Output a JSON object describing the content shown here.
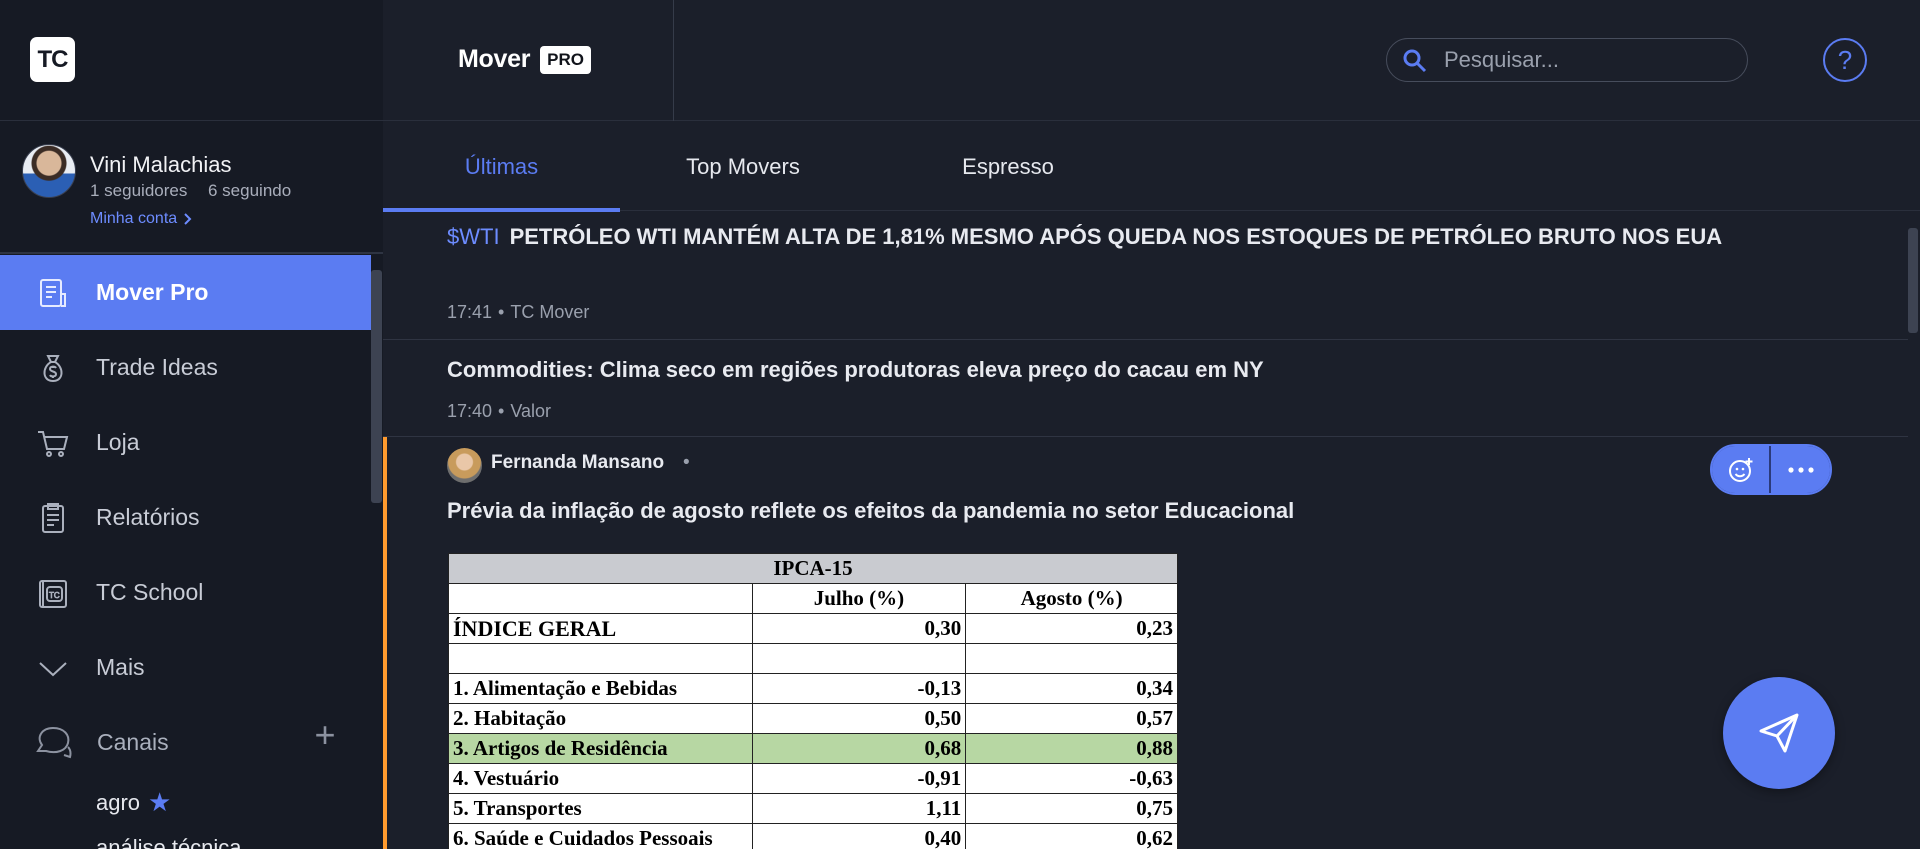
{
  "app": {
    "logo_text": "TC"
  },
  "user": {
    "name": "Vini Malachias",
    "followers": "1 seguidores",
    "following": "6 seguindo",
    "account_link": "Minha conta"
  },
  "nav": {
    "items": [
      {
        "label": "Mover Pro",
        "icon": "document-icon",
        "active": true
      },
      {
        "label": "Trade Ideas",
        "icon": "money-bag-icon",
        "active": false
      },
      {
        "label": "Loja",
        "icon": "cart-icon",
        "active": false
      },
      {
        "label": "Relatórios",
        "icon": "report-icon",
        "active": false
      },
      {
        "label": "TC School",
        "icon": "school-icon",
        "active": false
      },
      {
        "label": "Mais",
        "icon": "chevron-down-icon",
        "active": false
      }
    ]
  },
  "channels": {
    "label": "Canais",
    "items": [
      "agro",
      "análise técnica"
    ]
  },
  "header": {
    "brand": "Mover",
    "badge": "PRO",
    "search_placeholder": "Pesquisar...",
    "help": "?"
  },
  "tabs": [
    {
      "label": "Últimas",
      "active": true
    },
    {
      "label": "Top Movers",
      "active": false
    },
    {
      "label": "Espresso",
      "active": false
    }
  ],
  "feed": {
    "news": [
      {
        "ticker": "$WTI",
        "title": "PETRÓLEO WTI MANTÉM ALTA DE 1,81% MESMO APÓS QUEDA NOS ESTOQUES DE PETRÓLEO BRUTO NOS EUA",
        "time": "17:41",
        "source": "TC Mover"
      },
      {
        "ticker": "",
        "title": "Commodities: Clima seco em regiões produtoras eleva preço do cacau em NY",
        "time": "17:40",
        "source": "Valor"
      }
    ],
    "post": {
      "author": "Fernanda Mansano",
      "title": "Prévia da inflação de agosto reflete os efeitos da pandemia no setor Educacional",
      "accent_color": "#ff9b2e",
      "table": {
        "title": "IPCA-15",
        "columns": [
          "Julho (%)",
          "Agosto (%)"
        ],
        "rows": [
          {
            "label": "ÍNDICE GERAL",
            "julho": "0,30",
            "agosto": "0,23",
            "highlight": false
          },
          {
            "label": "",
            "julho": "",
            "agosto": "",
            "highlight": false
          },
          {
            "label": "1. Alimentação e Bebidas",
            "julho": "-0,13",
            "agosto": "0,34",
            "highlight": false
          },
          {
            "label": "2. Habitação",
            "julho": "0,50",
            "agosto": "0,57",
            "highlight": false
          },
          {
            "label": "3. Artigos de Residência",
            "julho": "0,68",
            "agosto": "0,88",
            "highlight": true
          },
          {
            "label": "4. Vestuário",
            "julho": "-0,91",
            "agosto": "-0,63",
            "highlight": false
          },
          {
            "label": "5. Transportes",
            "julho": "1,11",
            "agosto": "0,75",
            "highlight": false
          },
          {
            "label": "6. Saúde e Cuidados Pessoais",
            "julho": "0,40",
            "agosto": "0,62",
            "highlight": false
          }
        ]
      }
    }
  },
  "colors": {
    "accent": "#5b7cf2",
    "highlight_row": "#b7d7a3"
  }
}
